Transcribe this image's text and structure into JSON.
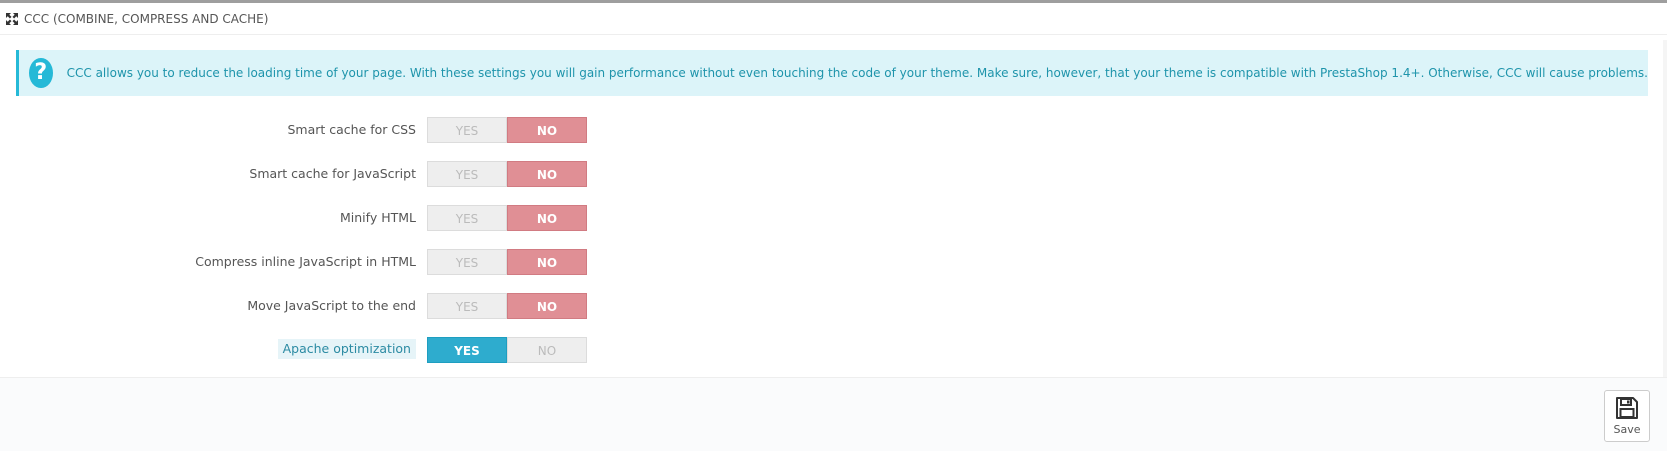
{
  "panel": {
    "title": "CCC (COMBINE, COMPRESS AND CACHE)",
    "icon": "expand-arrows-icon"
  },
  "alert": {
    "icon": "question-circle-icon",
    "text": "CCC allows you to reduce the loading time of your page. With these settings you will gain performance without even touching the code of your theme. Make sure, however, that your theme is compatible with PrestaShop 1.4+. Otherwise, CCC will cause problems."
  },
  "settings": [
    {
      "label": "Smart cache for CSS",
      "yes": "YES",
      "no": "NO",
      "value": "NO"
    },
    {
      "label": "Smart cache for JavaScript",
      "yes": "YES",
      "no": "NO",
      "value": "NO"
    },
    {
      "label": "Minify HTML",
      "yes": "YES",
      "no": "NO",
      "value": "NO"
    },
    {
      "label": "Compress inline JavaScript in HTML",
      "yes": "YES",
      "no": "NO",
      "value": "NO"
    },
    {
      "label": "Move JavaScript to the end",
      "yes": "YES",
      "no": "NO",
      "value": "NO"
    },
    {
      "label": "Apache optimization",
      "yes": "YES",
      "no": "NO",
      "value": "YES"
    }
  ],
  "footer": {
    "save_label": "Save",
    "save_icon": "floppy-disk-icon"
  },
  "colors": {
    "accent": "#25b9d7",
    "no_active": "#e08f95",
    "yes_active": "#2eacce"
  }
}
